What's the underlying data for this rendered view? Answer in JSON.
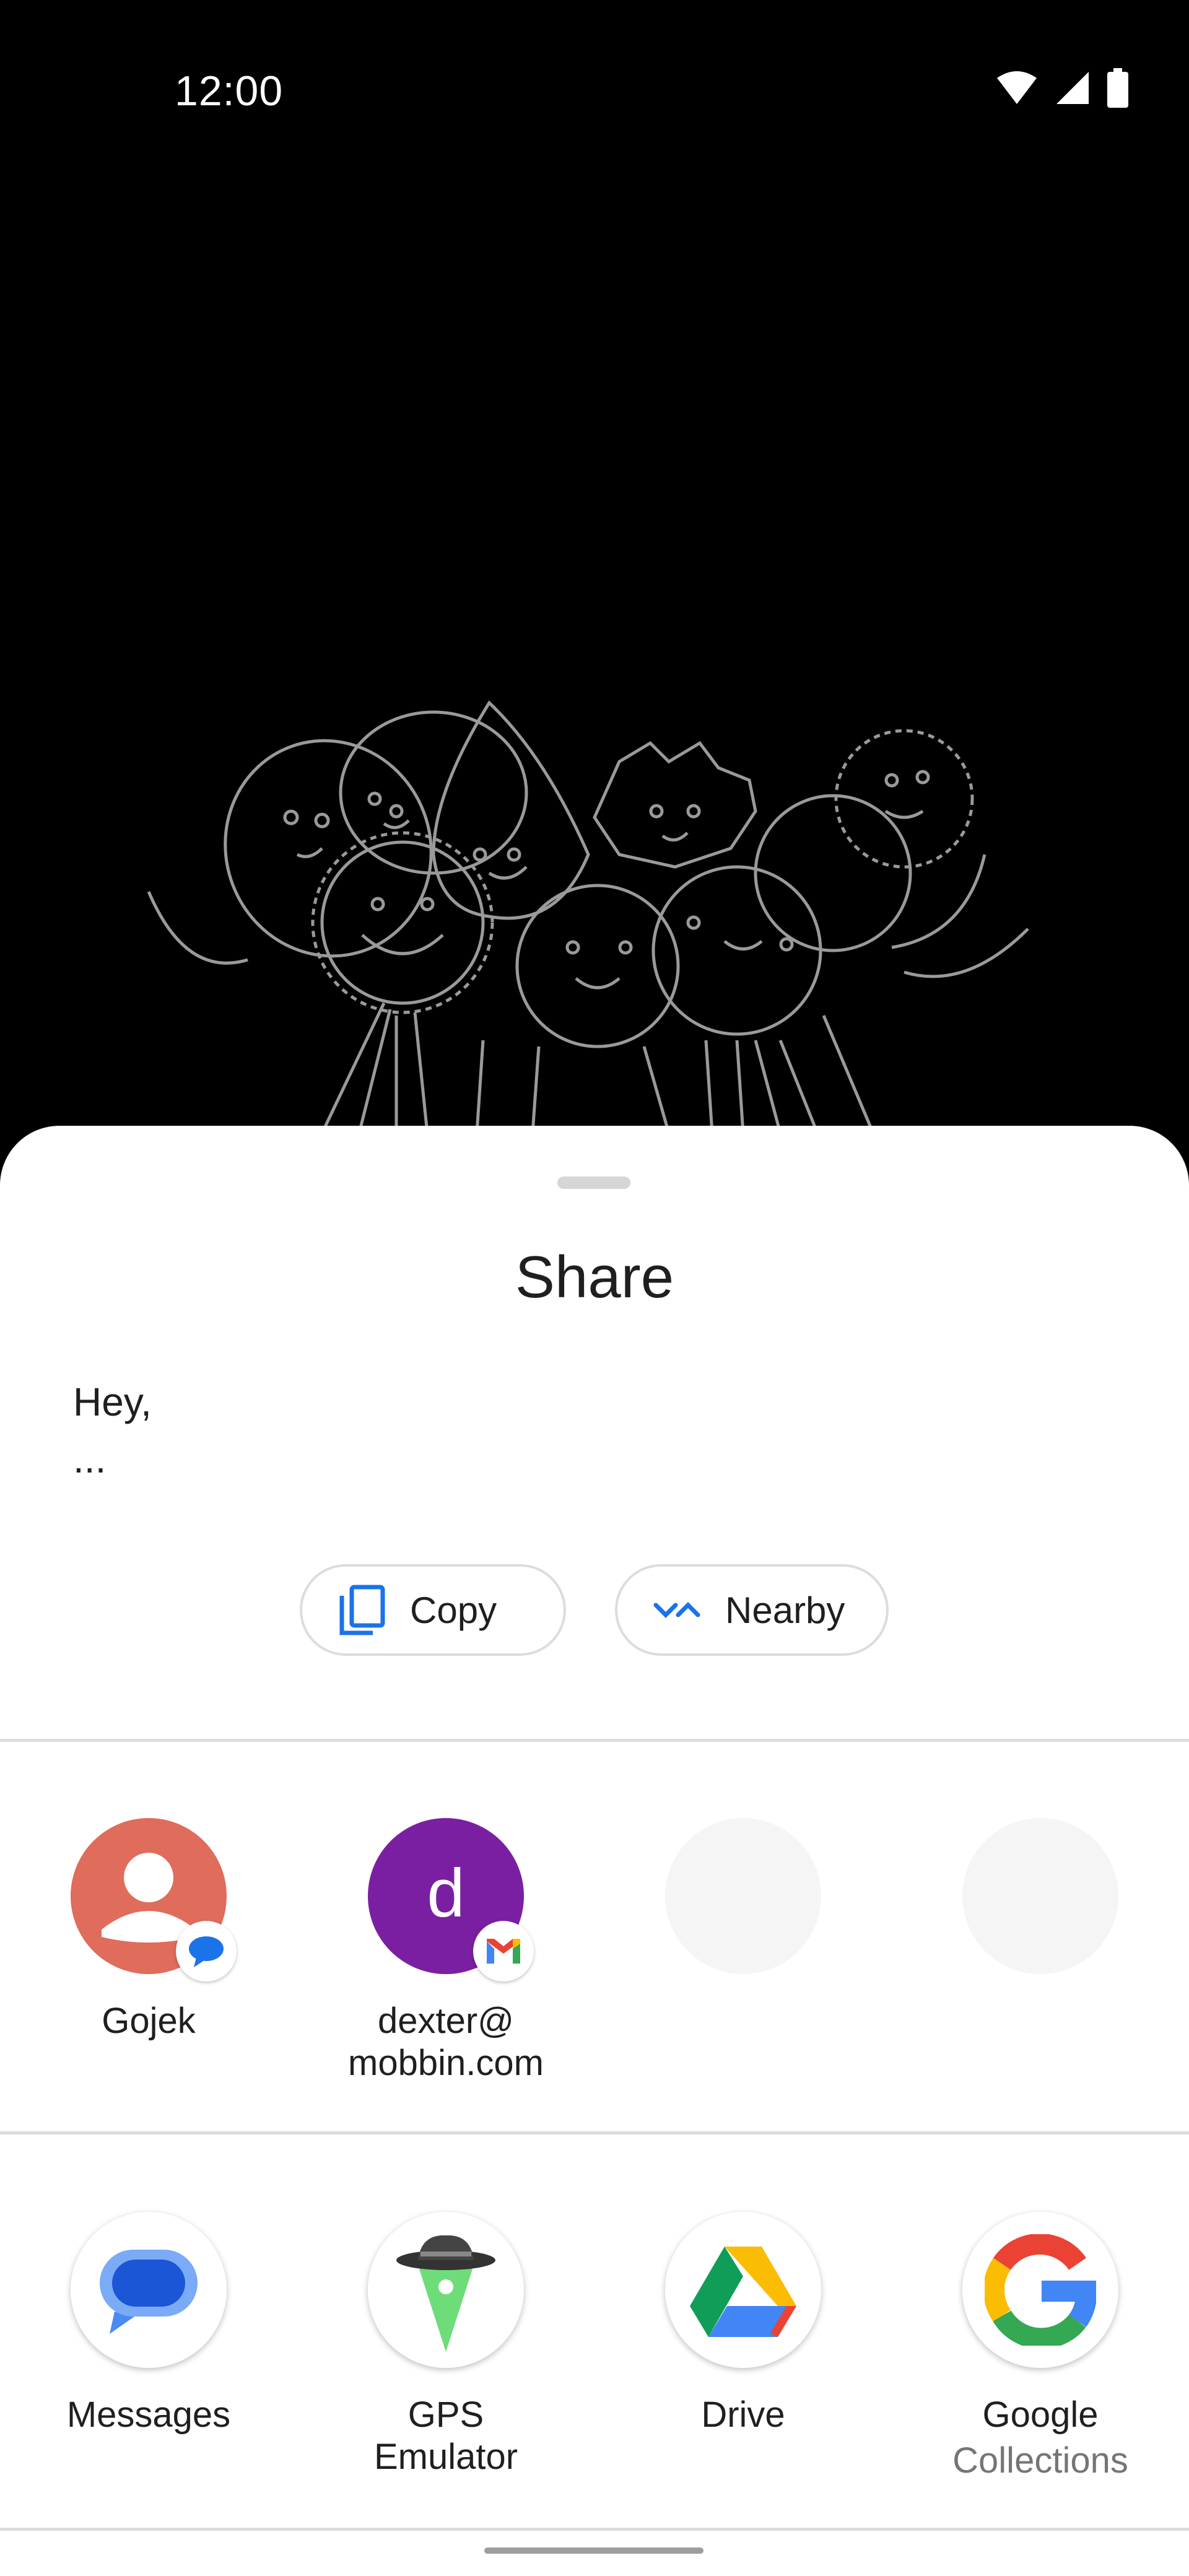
{
  "status_bar": {
    "time": "12:00"
  },
  "sheet": {
    "title": "Share",
    "preview_line1": "Hey,",
    "preview_line2": "...",
    "copy_label": "Copy",
    "nearby_label": "Nearby"
  },
  "direct_share": [
    {
      "name": "Gojek",
      "avatar_color": "#e06c5c",
      "badge_app": "messages-icon"
    },
    {
      "name_line1": "dexter@",
      "name_line2": "mobbin.com",
      "avatar_letter": "d",
      "avatar_color": "#7b1fa2",
      "badge_app": "gmail-icon"
    }
  ],
  "apps": [
    {
      "name": "Messages"
    },
    {
      "name": "GPS Emulator"
    },
    {
      "name": "Drive"
    },
    {
      "name": "Google",
      "sub": "Collections"
    }
  ],
  "colors": {
    "accent_blue": "#1a73e8",
    "sheet_bg": "#ffffff",
    "backdrop": "#000000"
  }
}
